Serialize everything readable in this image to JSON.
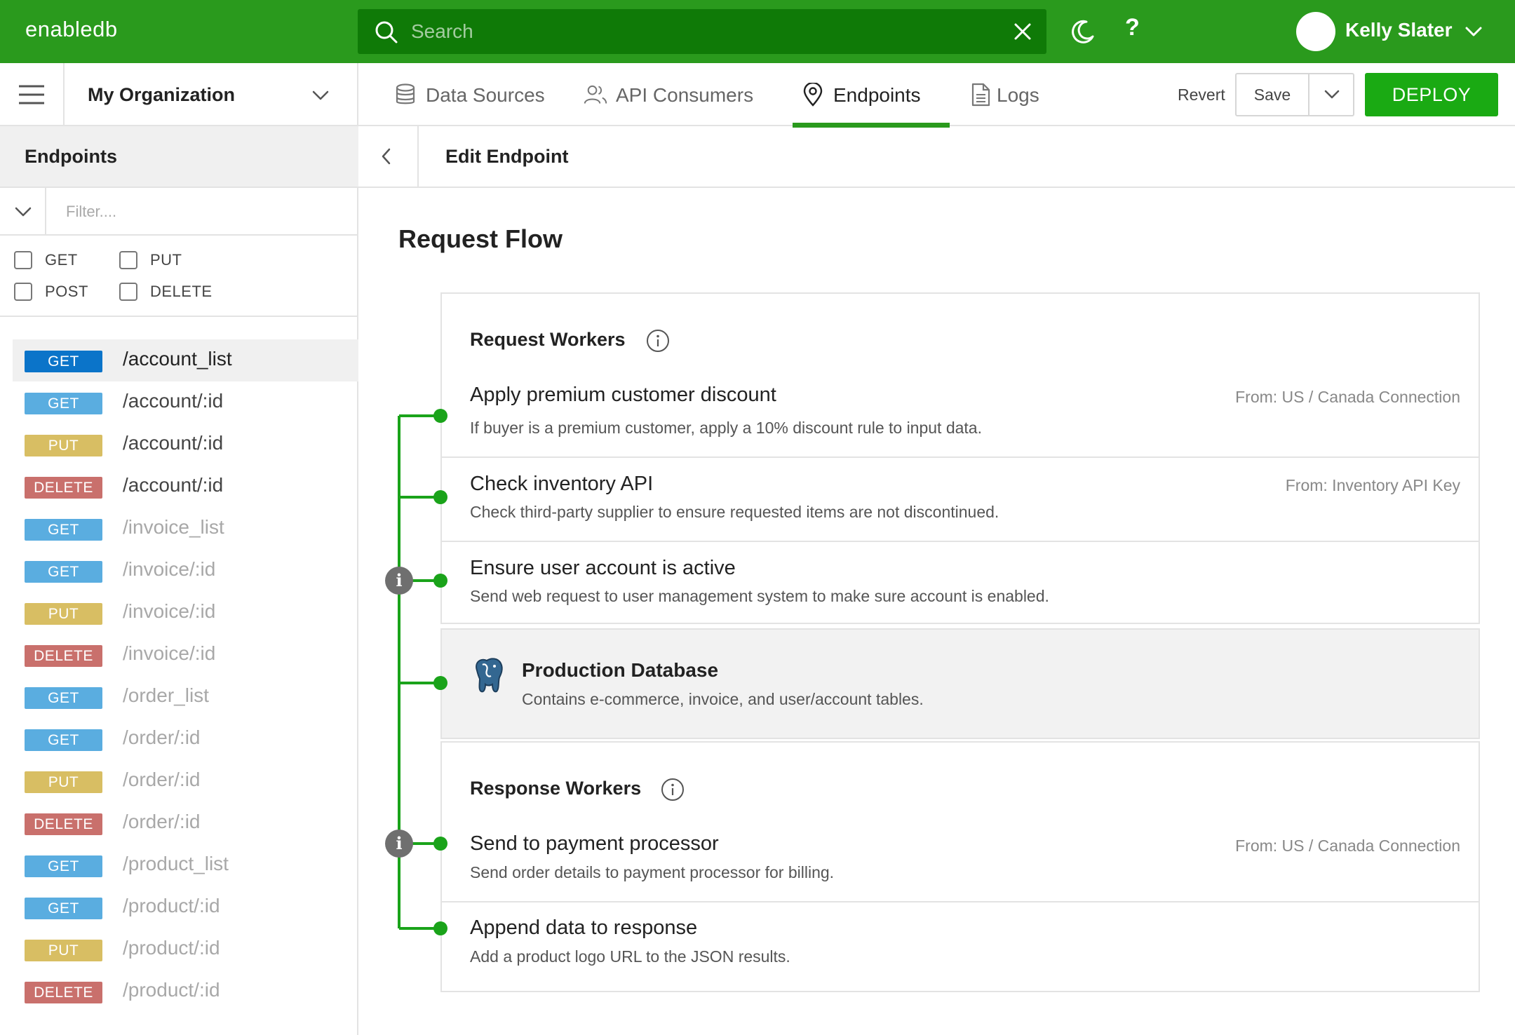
{
  "app": {
    "brand": "enabledb"
  },
  "search": {
    "placeholder": "Search"
  },
  "user": {
    "name": "Kelly Slater"
  },
  "top_icons": [
    "search-icon",
    "close-icon",
    "moon-icon",
    "help-icon",
    "chevron-down-icon"
  ],
  "help_label": "?",
  "org": {
    "name": "My Organization"
  },
  "sidebar": {
    "title": "Endpoints",
    "filter_placeholder": "Filter....",
    "methods": [
      {
        "label": "GET",
        "checked": false
      },
      {
        "label": "PUT",
        "checked": false
      },
      {
        "label": "POST",
        "checked": false
      },
      {
        "label": "DELETE",
        "checked": false
      }
    ],
    "endpoints": [
      {
        "method": "GET",
        "path": "/account_list",
        "active": true
      },
      {
        "method": "GET",
        "path": "/account/:id"
      },
      {
        "method": "PUT",
        "path": "/account/:id"
      },
      {
        "method": "DELETE",
        "path": "/account/:id"
      },
      {
        "method": "GET",
        "path": "/invoice_list",
        "muted": true
      },
      {
        "method": "GET",
        "path": "/invoice/:id",
        "muted": true
      },
      {
        "method": "PUT",
        "path": "/invoice/:id",
        "muted": true
      },
      {
        "method": "DELETE",
        "path": "/invoice/:id",
        "muted": true
      },
      {
        "method": "GET",
        "path": "/order_list",
        "muted": true
      },
      {
        "method": "GET",
        "path": "/order/:id",
        "muted": true
      },
      {
        "method": "PUT",
        "path": "/order/:id",
        "muted": true
      },
      {
        "method": "DELETE",
        "path": "/order/:id",
        "muted": true
      },
      {
        "method": "GET",
        "path": "/product_list",
        "muted": true
      },
      {
        "method": "GET",
        "path": "/product/:id",
        "muted": true
      },
      {
        "method": "PUT",
        "path": "/product/:id",
        "muted": true
      },
      {
        "method": "DELETE",
        "path": "/product/:id",
        "muted": true
      }
    ]
  },
  "colors": {
    "brand_green": "#2a9a1d",
    "deploy_green": "#1aaa13",
    "get_active": "#0b74c9",
    "get": "#5aade0",
    "put": "#d8be63",
    "delete": "#c9706c",
    "tree_green": "#1aa31a"
  },
  "nav": {
    "tabs": [
      {
        "label": "Data Sources",
        "icon": "database-icon"
      },
      {
        "label": "API Consumers",
        "icon": "users-icon"
      },
      {
        "label": "Endpoints",
        "icon": "location-pin-icon",
        "active": true
      },
      {
        "label": "Logs",
        "icon": "document-icon"
      }
    ],
    "revert": "Revert",
    "save": "Save",
    "deploy": "DEPLOY"
  },
  "edit": {
    "title": "Edit Endpoint"
  },
  "flow": {
    "title": "Request Flow",
    "request_section": "Request Workers",
    "request_workers": [
      {
        "title": "Apply premium customer discount",
        "desc": "If buyer is a premium customer, apply a 10% discount rule to input data.",
        "from": "From: US / Canada Connection"
      },
      {
        "title": "Check inventory API",
        "desc": "Check third-party supplier to ensure requested items are not discontinued.",
        "from": "From: Inventory API Key"
      },
      {
        "title": "Ensure user account is active",
        "desc": "Send web request to user management system to make sure account is enabled.",
        "from": ""
      }
    ],
    "database": {
      "title": "Production Database",
      "desc": "Contains e-commerce, invoice, and user/account tables.",
      "icon": "postgresql-elephant-icon"
    },
    "response_section": "Response Workers",
    "response_workers": [
      {
        "title": "Send to payment processor",
        "desc": "Send order details to payment processor for billing.",
        "from": "From: US / Canada Connection"
      },
      {
        "title": "Append data to response",
        "desc": "Add a product logo URL to the JSON results.",
        "from": ""
      }
    ],
    "tree_info_label": "i"
  }
}
